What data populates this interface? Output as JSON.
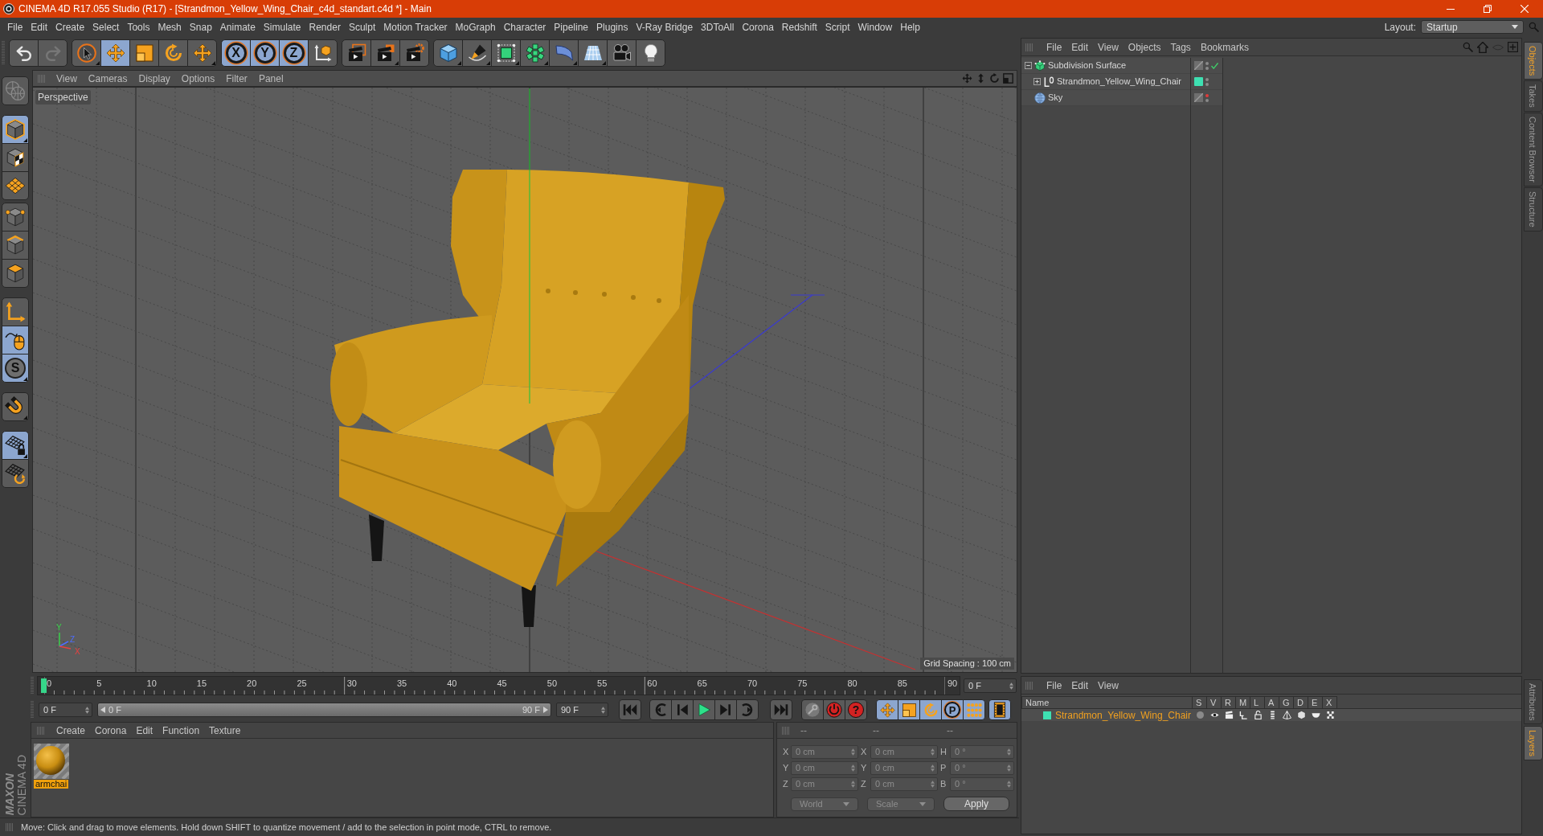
{
  "window": {
    "title": "CINEMA 4D R17.055 Studio (R17) - [Strandmon_Yellow_Wing_Chair_c4d_standart.c4d *] - Main"
  },
  "menu_bar": [
    "File",
    "Edit",
    "Create",
    "Select",
    "Tools",
    "Mesh",
    "Snap",
    "Animate",
    "Simulate",
    "Render",
    "Sculpt",
    "Motion Tracker",
    "MoGraph",
    "Character",
    "Pipeline",
    "Plugins",
    "V-Ray Bridge",
    "3DToAll",
    "Corona",
    "Redshift",
    "Script",
    "Window",
    "Help"
  ],
  "layout": {
    "label": "Layout:",
    "value": "Startup"
  },
  "toolbar": {
    "history": [
      {
        "disabled": false
      },
      {
        "disabled": true
      }
    ],
    "tools": [
      {
        "selected": false
      },
      {
        "selected": true
      },
      {
        "selected": false
      },
      {
        "selected": false
      },
      {
        "selected": false
      }
    ],
    "axes": [
      {
        "label": "X",
        "selected": true
      },
      {
        "label": "Y",
        "selected": true
      },
      {
        "label": "Z",
        "selected": true
      }
    ]
  },
  "left_toolbar": {
    "make_editable": {
      "disabled": true
    },
    "modes": [
      {
        "selected": true
      },
      {
        "selected": false
      },
      {
        "selected": false
      }
    ],
    "components": [
      {
        "selected": false
      },
      {
        "selected": false
      },
      {
        "selected": false
      }
    ],
    "tools": [
      {
        "selected": false
      },
      {
        "selected": true
      },
      {
        "label": "S",
        "selected": true
      }
    ],
    "magnet": {
      "selected": false
    },
    "workplane": [
      {
        "selected": true
      },
      {
        "selected": false
      }
    ]
  },
  "viewport": {
    "menu": [
      "View",
      "Cameras",
      "Display",
      "Options",
      "Filter",
      "Panel"
    ],
    "camera": "Perspective",
    "grid_spacing": "Grid Spacing : 100 cm",
    "gizmo_labels": [
      "Y",
      "Z",
      "X"
    ]
  },
  "timeline": {
    "ticks": [
      "0",
      "5",
      "10",
      "15",
      "20",
      "25",
      "30",
      "35",
      "40",
      "45",
      "50",
      "55",
      "60",
      "65",
      "70",
      "75",
      "80",
      "85",
      "90"
    ],
    "level": 0,
    "current_frame": "0 F"
  },
  "transport": {
    "start": "0 F",
    "range": {
      "start": "0 F",
      "end": "90 F",
      "level": 1
    },
    "end": "90 F",
    "keyframe_label": "?",
    "tracks": [
      {
        "selected": true
      },
      {
        "selected": true
      },
      {
        "selected": true
      },
      {
        "label": "P",
        "selected": true
      },
      {
        "selected": true
      }
    ],
    "timeline_button": {
      "selected": true
    }
  },
  "materials": {
    "menu": [
      "Create",
      "Corona",
      "Edit",
      "Function",
      "Texture"
    ],
    "items": [
      {
        "name": "armchai",
        "selected": true
      }
    ]
  },
  "coordinates": {
    "headers": [
      "--",
      "--",
      "--"
    ],
    "rows": [
      {
        "position_label": "X",
        "position": "0 cm",
        "size_label": "X",
        "size": "0 cm",
        "rotation_label": "H",
        "rotation": "0 °"
      },
      {
        "position_label": "Y",
        "position": "0 cm",
        "size_label": "Y",
        "size": "0 cm",
        "rotation_label": "P",
        "rotation": "0 °"
      },
      {
        "position_label": "Z",
        "position": "0 cm",
        "size_label": "Z",
        "size": "0 cm",
        "rotation_label": "B",
        "rotation": "0 °"
      }
    ],
    "mode": "World",
    "size_mode": "Scale",
    "apply": "Apply"
  },
  "logo": {
    "brand": "MAXON",
    "product": "CINEMA 4D"
  },
  "status_bar": {
    "text": "Move: Click and drag to move elements. Hold down SHIFT to quantize movement / add to the selection in point mode, CTRL to remove."
  },
  "objects": {
    "menu": [
      "File",
      "Edit",
      "View",
      "Objects",
      "Tags",
      "Bookmarks"
    ],
    "items": [
      {
        "kind": "subdivision",
        "name": "Subdivision Surface",
        "expanded": true,
        "enabled": true,
        "hidden_in_editor": false,
        "children": [
          {
            "kind": "null",
            "name": "Strandmon_Yellow_Wing_Chair",
            "expanded": false,
            "color": "#3ee0b2",
            "hidden_in_editor": false
          }
        ]
      },
      {
        "kind": "sky",
        "name": "Sky",
        "hidden_in_editor": true
      }
    ]
  },
  "layers": {
    "menu": [
      "File",
      "Edit",
      "View"
    ],
    "columns": [
      "Name",
      "S",
      "V",
      "R",
      "M",
      "L",
      "A",
      "G",
      "D",
      "E",
      "X"
    ],
    "items": [
      {
        "name": "Strandmon_Yellow_Wing_Chair",
        "color": "#3ee0b2",
        "selected": true,
        "solo": false
      }
    ]
  },
  "side_tabs": {
    "top": [
      {
        "label": "Objects",
        "selected": true
      },
      {
        "label": "Takes",
        "selected": false
      },
      {
        "label": "Content Browser",
        "selected": false
      },
      {
        "label": "Structure",
        "selected": false
      }
    ],
    "bottom": [
      {
        "label": "Attributes",
        "selected": false
      },
      {
        "label": "Layers",
        "selected": true
      }
    ]
  }
}
